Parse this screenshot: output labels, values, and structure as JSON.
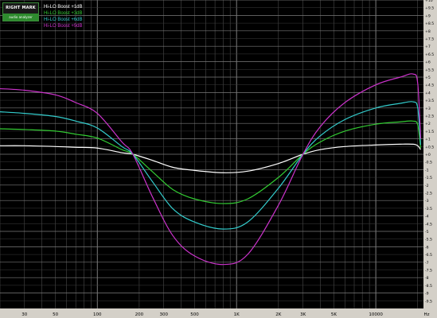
{
  "logo": {
    "brand_text": "RIGHT MARK",
    "sub_text": "audio analyzer"
  },
  "colors": {
    "background": "#000000",
    "grid": "#5a5a5a",
    "frame": "#d4d0c8",
    "series_1": "#ffffff",
    "series_2": "#33cc33",
    "series_3": "#33cccc",
    "series_4": "#cc33cc"
  },
  "chart_data": {
    "type": "line",
    "title": "",
    "xlabel": "",
    "ylabel": "",
    "x_scale": "log",
    "x_unit": "Hz",
    "xlim": [
      20,
      22000
    ],
    "ylim": [
      -10,
      10
    ],
    "grid": true,
    "legend_position": "top-left",
    "x_ticks": [
      {
        "value": 30,
        "label": "30"
      },
      {
        "value": 50,
        "label": "50"
      },
      {
        "value": 100,
        "label": "100"
      },
      {
        "value": 200,
        "label": "200"
      },
      {
        "value": 300,
        "label": "300"
      },
      {
        "value": 500,
        "label": "500"
      },
      {
        "value": 1000,
        "label": "1K"
      },
      {
        "value": 2000,
        "label": "2K"
      },
      {
        "value": 3000,
        "label": "3K"
      },
      {
        "value": 5000,
        "label": "5K"
      },
      {
        "value": 10000,
        "label": "10000"
      },
      {
        "value": 20000,
        "label": "Hz"
      }
    ],
    "y_ticks": [
      {
        "value": 10,
        "label": "+10"
      },
      {
        "value": 9.5,
        "label": "+9.5"
      },
      {
        "value": 9,
        "label": "+9"
      },
      {
        "value": 8.5,
        "label": "+8.5"
      },
      {
        "value": 8,
        "label": "+8"
      },
      {
        "value": 7.5,
        "label": "+7.5"
      },
      {
        "value": 7,
        "label": "+7"
      },
      {
        "value": 6.5,
        "label": "+6.5"
      },
      {
        "value": 6,
        "label": "+6"
      },
      {
        "value": 5.5,
        "label": "+5.5"
      },
      {
        "value": 5,
        "label": "+5"
      },
      {
        "value": 4.5,
        "label": "+4.5"
      },
      {
        "value": 4,
        "label": "+4"
      },
      {
        "value": 3.5,
        "label": "+3.5"
      },
      {
        "value": 3,
        "label": "+3"
      },
      {
        "value": 2.5,
        "label": "+2.5"
      },
      {
        "value": 2,
        "label": "+2"
      },
      {
        "value": 1.5,
        "label": "+1.5"
      },
      {
        "value": 1,
        "label": "+1"
      },
      {
        "value": 0.5,
        "label": "+0.5"
      },
      {
        "value": 0,
        "label": "+0"
      },
      {
        "value": -0.5,
        "label": "-0.5"
      },
      {
        "value": -1,
        "label": "-1"
      },
      {
        "value": -1.5,
        "label": "-1.5"
      },
      {
        "value": -2,
        "label": "-2"
      },
      {
        "value": -2.5,
        "label": "-2.5"
      },
      {
        "value": -3,
        "label": "-3"
      },
      {
        "value": -3.5,
        "label": "-3.5"
      },
      {
        "value": -4,
        "label": "-4"
      },
      {
        "value": -4.5,
        "label": "-4.5"
      },
      {
        "value": -5,
        "label": "-5"
      },
      {
        "value": -5.5,
        "label": "-5.5"
      },
      {
        "value": -6,
        "label": "-6"
      },
      {
        "value": -6.5,
        "label": "-6.5"
      },
      {
        "value": -7,
        "label": "-7"
      },
      {
        "value": -7.5,
        "label": "-7.5"
      },
      {
        "value": -8,
        "label": "-8"
      },
      {
        "value": -8.5,
        "label": "-8.5"
      },
      {
        "value": -9,
        "label": "-9"
      },
      {
        "value": -9.5,
        "label": "-9.5"
      }
    ],
    "series": [
      {
        "name": "Hi-LO Boost +1dB",
        "color": "#ffffff",
        "points": [
          [
            20,
            0.55
          ],
          [
            30,
            0.55
          ],
          [
            50,
            0.5
          ],
          [
            70,
            0.45
          ],
          [
            100,
            0.4
          ],
          [
            150,
            0.1
          ],
          [
            180,
            0
          ],
          [
            250,
            -0.4
          ],
          [
            350,
            -0.85
          ],
          [
            500,
            -1.05
          ],
          [
            800,
            -1.2
          ],
          [
            1200,
            -1.1
          ],
          [
            2000,
            -0.6
          ],
          [
            3000,
            0
          ],
          [
            4000,
            0.3
          ],
          [
            6000,
            0.5
          ],
          [
            10000,
            0.6
          ],
          [
            15000,
            0.65
          ],
          [
            18500,
            0.65
          ],
          [
            20000,
            0.55
          ],
          [
            21000,
            0.3
          ]
        ]
      },
      {
        "name": "Hi-LO Boost +3dB",
        "color": "#33cc33",
        "points": [
          [
            20,
            1.65
          ],
          [
            30,
            1.6
          ],
          [
            50,
            1.5
          ],
          [
            70,
            1.3
          ],
          [
            100,
            1.05
          ],
          [
            150,
            0.3
          ],
          [
            180,
            0
          ],
          [
            250,
            -1.15
          ],
          [
            350,
            -2.3
          ],
          [
            500,
            -2.9
          ],
          [
            800,
            -3.2
          ],
          [
            1200,
            -2.9
          ],
          [
            2000,
            -1.5
          ],
          [
            3000,
            0
          ],
          [
            4000,
            0.8
          ],
          [
            6000,
            1.5
          ],
          [
            10000,
            1.95
          ],
          [
            15000,
            2.1
          ],
          [
            18500,
            2.15
          ],
          [
            20000,
            1.9
          ],
          [
            21000,
            0.4
          ]
        ]
      },
      {
        "name": "Hi-LO Boost +6dB",
        "color": "#33cccc",
        "points": [
          [
            20,
            2.75
          ],
          [
            30,
            2.65
          ],
          [
            50,
            2.45
          ],
          [
            70,
            2.15
          ],
          [
            100,
            1.7
          ],
          [
            150,
            0.5
          ],
          [
            180,
            0
          ],
          [
            250,
            -1.8
          ],
          [
            350,
            -3.55
          ],
          [
            500,
            -4.4
          ],
          [
            800,
            -4.85
          ],
          [
            1200,
            -4.4
          ],
          [
            2000,
            -2.2
          ],
          [
            3000,
            0
          ],
          [
            4000,
            1.2
          ],
          [
            6000,
            2.25
          ],
          [
            10000,
            3.0
          ],
          [
            15000,
            3.3
          ],
          [
            18500,
            3.4
          ],
          [
            20000,
            3.0
          ],
          [
            21000,
            0.6
          ]
        ]
      },
      {
        "name": "Hi-LO Boost +9dB",
        "color": "#cc33cc",
        "points": [
          [
            20,
            4.25
          ],
          [
            30,
            4.15
          ],
          [
            50,
            3.85
          ],
          [
            70,
            3.35
          ],
          [
            100,
            2.65
          ],
          [
            150,
            0.8
          ],
          [
            180,
            0
          ],
          [
            250,
            -2.8
          ],
          [
            350,
            -5.3
          ],
          [
            500,
            -6.6
          ],
          [
            800,
            -7.15
          ],
          [
            1200,
            -6.5
          ],
          [
            2000,
            -3.3
          ],
          [
            3000,
            0
          ],
          [
            4000,
            1.8
          ],
          [
            6000,
            3.35
          ],
          [
            10000,
            4.5
          ],
          [
            15000,
            5.0
          ],
          [
            18500,
            5.2
          ],
          [
            20000,
            4.6
          ],
          [
            21000,
            1.0
          ]
        ]
      }
    ]
  }
}
